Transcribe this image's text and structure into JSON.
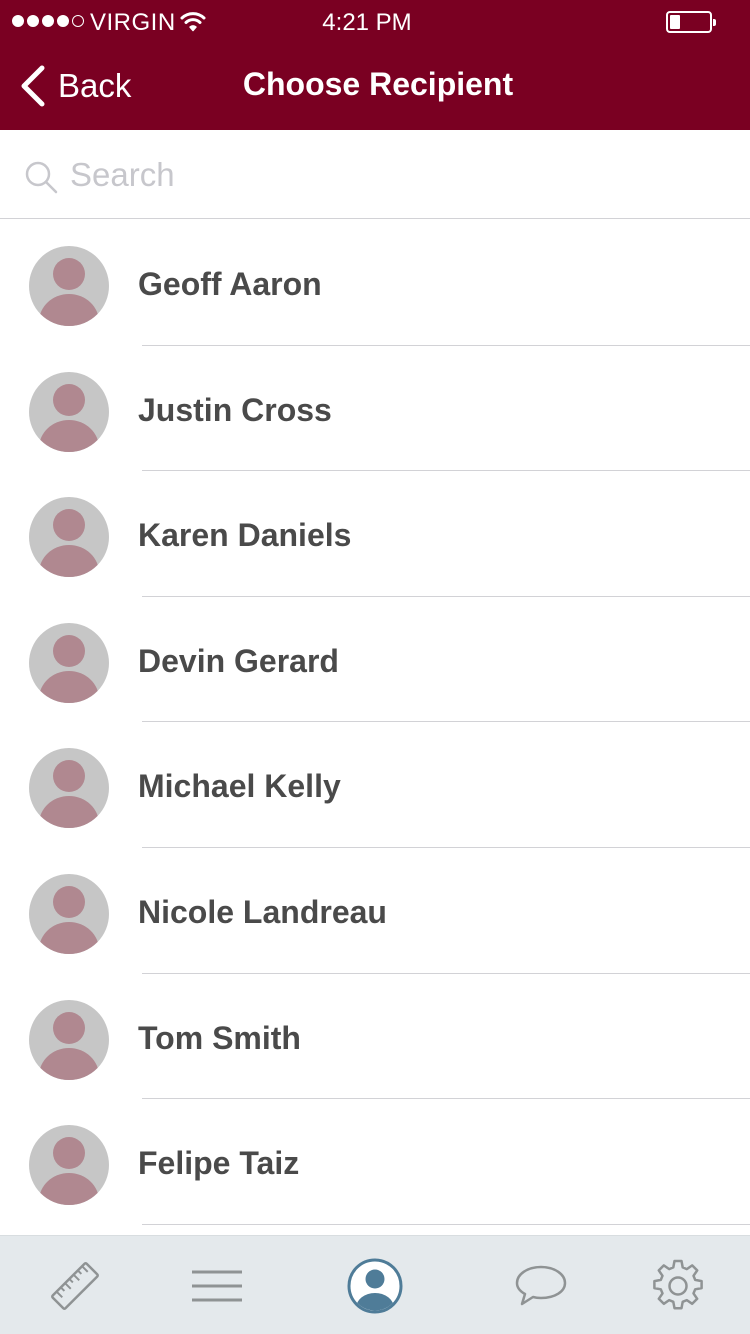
{
  "status_bar": {
    "carrier": "VIRGIN",
    "time": "4:21 PM",
    "signal_bars_filled": 4,
    "signal_bars_total": 5,
    "battery_level": 0.25
  },
  "nav": {
    "back_label": "Back",
    "title": "Choose Recipient"
  },
  "search": {
    "placeholder": "Search",
    "value": ""
  },
  "recipients": [
    {
      "name": "Geoff Aaron"
    },
    {
      "name": "Justin Cross"
    },
    {
      "name": "Karen Daniels"
    },
    {
      "name": "Devin Gerard"
    },
    {
      "name": "Michael Kelly"
    },
    {
      "name": "Nicole Landreau"
    },
    {
      "name": "Tom Smith"
    },
    {
      "name": "Felipe Taiz"
    }
  ],
  "tabs": [
    {
      "icon": "ruler-icon",
      "active": false
    },
    {
      "icon": "menu-icon",
      "active": false
    },
    {
      "icon": "profile-icon",
      "active": true
    },
    {
      "icon": "chat-bubble-icon",
      "active": false
    },
    {
      "icon": "gear-icon",
      "active": false
    }
  ],
  "colors": {
    "header": "#7a0022",
    "tab_active": "#4f7c98",
    "tab_inactive": "#8f9394",
    "avatar_bg": "#c6c6c6",
    "avatar_figure": "#b08890"
  }
}
